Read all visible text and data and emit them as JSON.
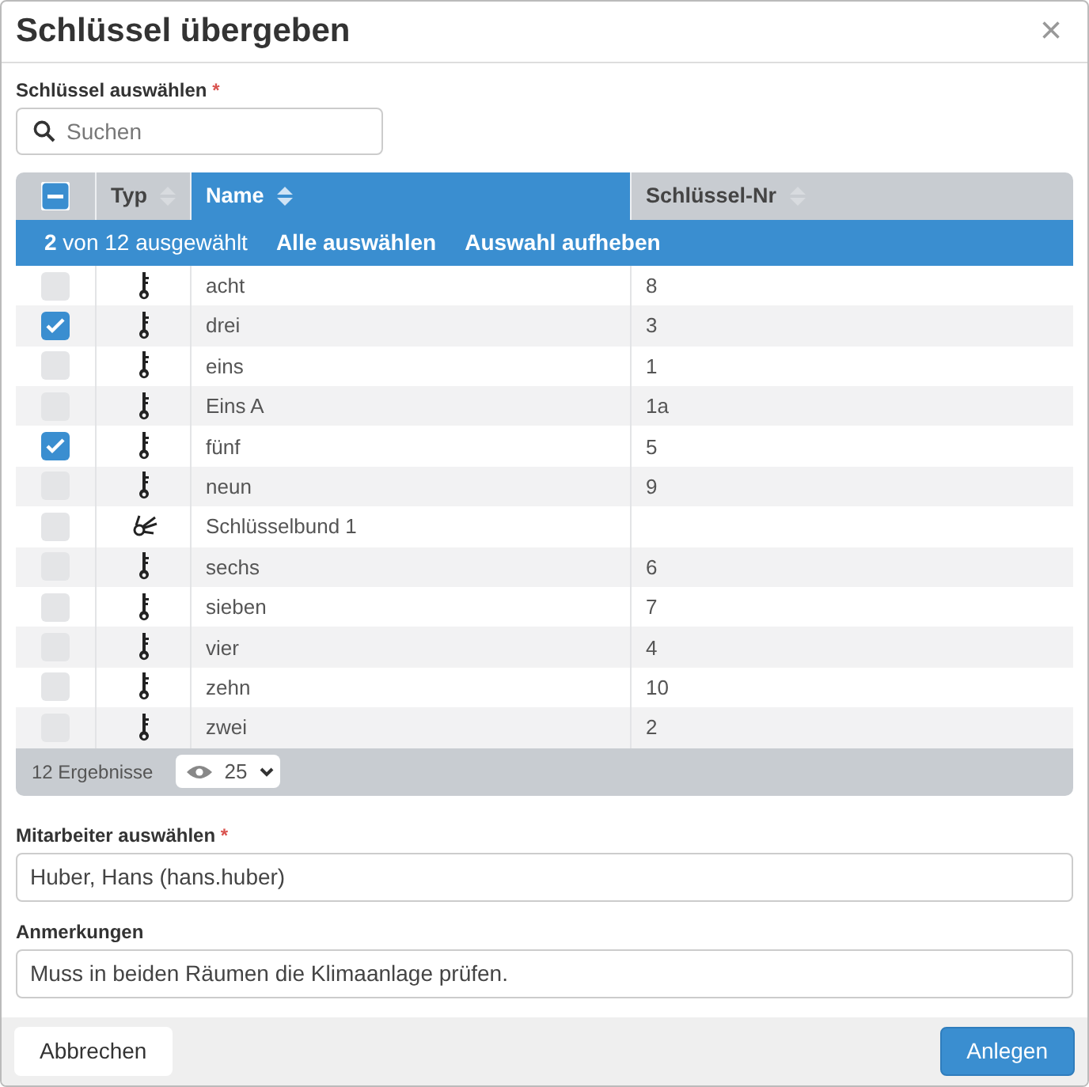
{
  "dialog": {
    "title": "Schlüssel übergeben",
    "close": "×"
  },
  "key_field": {
    "label": "Schlüssel auswählen",
    "required": "*",
    "placeholder": "Suchen"
  },
  "table": {
    "header_partially_checked": true,
    "columns": [
      {
        "label": "Typ",
        "sorted": false
      },
      {
        "label": "Name",
        "sorted": true
      },
      {
        "label": "Schlüssel-Nr",
        "sorted": false
      }
    ],
    "selection_bar": {
      "summary": "**2** von 12 ausgewählt",
      "select_all": "Alle auswählen",
      "clear": "Auswahl aufheben"
    },
    "rows": [
      {
        "kind": "key",
        "name": "acht",
        "number": "8",
        "checked": false
      },
      {
        "kind": "key",
        "name": "drei",
        "number": "3",
        "checked": true
      },
      {
        "kind": "key",
        "name": "eins",
        "number": "1",
        "checked": false
      },
      {
        "kind": "key",
        "name": "Eins A",
        "number": "1a",
        "checked": false
      },
      {
        "kind": "key",
        "name": "fünf",
        "number": "5",
        "checked": true
      },
      {
        "kind": "key",
        "name": "neun",
        "number": "9",
        "checked": false
      },
      {
        "kind": "keyring",
        "name": "Schlüsselbund 1",
        "number": "",
        "checked": false
      },
      {
        "kind": "key",
        "name": "sechs",
        "number": "6",
        "checked": false
      },
      {
        "kind": "key",
        "name": "sieben",
        "number": "7",
        "checked": false
      },
      {
        "kind": "key",
        "name": "vier",
        "number": "4",
        "checked": false
      },
      {
        "kind": "key",
        "name": "zehn",
        "number": "10",
        "checked": false
      },
      {
        "kind": "key",
        "name": "zwei",
        "number": "2",
        "checked": false
      }
    ],
    "footer": {
      "results": "12 Ergebnisse",
      "page_size": "25"
    }
  },
  "employee_field": {
    "label": "Mitarbeiter auswählen",
    "required": "*",
    "value": "Huber, Hans (hans.huber)"
  },
  "notes_field": {
    "label": "Anmerkungen",
    "value": "Muss in beiden Räumen die Klimaanlage prüfen."
  },
  "buttons": [
    {
      "label": "Abbrechen",
      "kind": "secondary"
    },
    {
      "label": "Anlegen",
      "kind": "primary"
    }
  ]
}
